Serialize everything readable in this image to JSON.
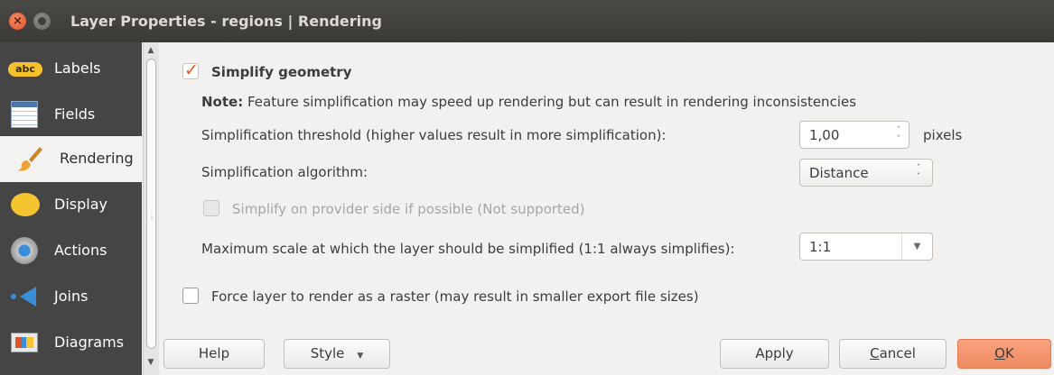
{
  "window": {
    "title": "Layer Properties - regions | Rendering",
    "close_glyph": "×"
  },
  "sidebar": {
    "items": [
      {
        "label": "Labels",
        "icon": "labels-abc-icon",
        "icon_text": "abc"
      },
      {
        "label": "Fields",
        "icon": "fields-table-icon"
      },
      {
        "label": "Rendering",
        "icon": "paintbrush-icon",
        "active": true
      },
      {
        "label": "Display",
        "icon": "speech-bubble-icon"
      },
      {
        "label": "Actions",
        "icon": "gear-actions-icon"
      },
      {
        "label": "Joins",
        "icon": "joins-arrow-icon"
      },
      {
        "label": "Diagrams",
        "icon": "diagrams-icon"
      }
    ],
    "scrollbar": {
      "up": "▲",
      "down": "▼",
      "grip": "⋮"
    }
  },
  "rendering": {
    "simplify_geometry": {
      "label": "Simplify geometry",
      "checked": true
    },
    "note_prefix": "Note:",
    "note_text": "Feature simplification may speed up rendering but can result in rendering inconsistencies",
    "threshold": {
      "label": "Simplification threshold (higher values result in more simplification):",
      "value": "1,00",
      "unit": "pixels"
    },
    "algorithm": {
      "label": "Simplification algorithm:",
      "value": "Distance"
    },
    "provider_side": {
      "label": "Simplify on provider side if possible (Not supported)",
      "checked": false,
      "enabled": false
    },
    "max_scale": {
      "label": "Maximum scale at which the layer should be simplified (1:1 always simplifies):",
      "value": "1:1"
    },
    "force_raster": {
      "label": "Force layer to render as a raster (may result in smaller export file sizes)",
      "checked": false
    }
  },
  "buttons": {
    "help": "Help",
    "style": "Style",
    "apply": "Apply",
    "cancel_first": "C",
    "cancel_rest": "ancel",
    "ok_first": "O",
    "ok_rest": "K"
  },
  "glyphs": {
    "spin_up": "˄",
    "spin_down": "˅",
    "dropdown": "▼"
  },
  "colors": {
    "titlebar": "#3b3a37",
    "sidebar": "#454545",
    "accent": "#e95420",
    "ok_button": "#f08a62"
  }
}
